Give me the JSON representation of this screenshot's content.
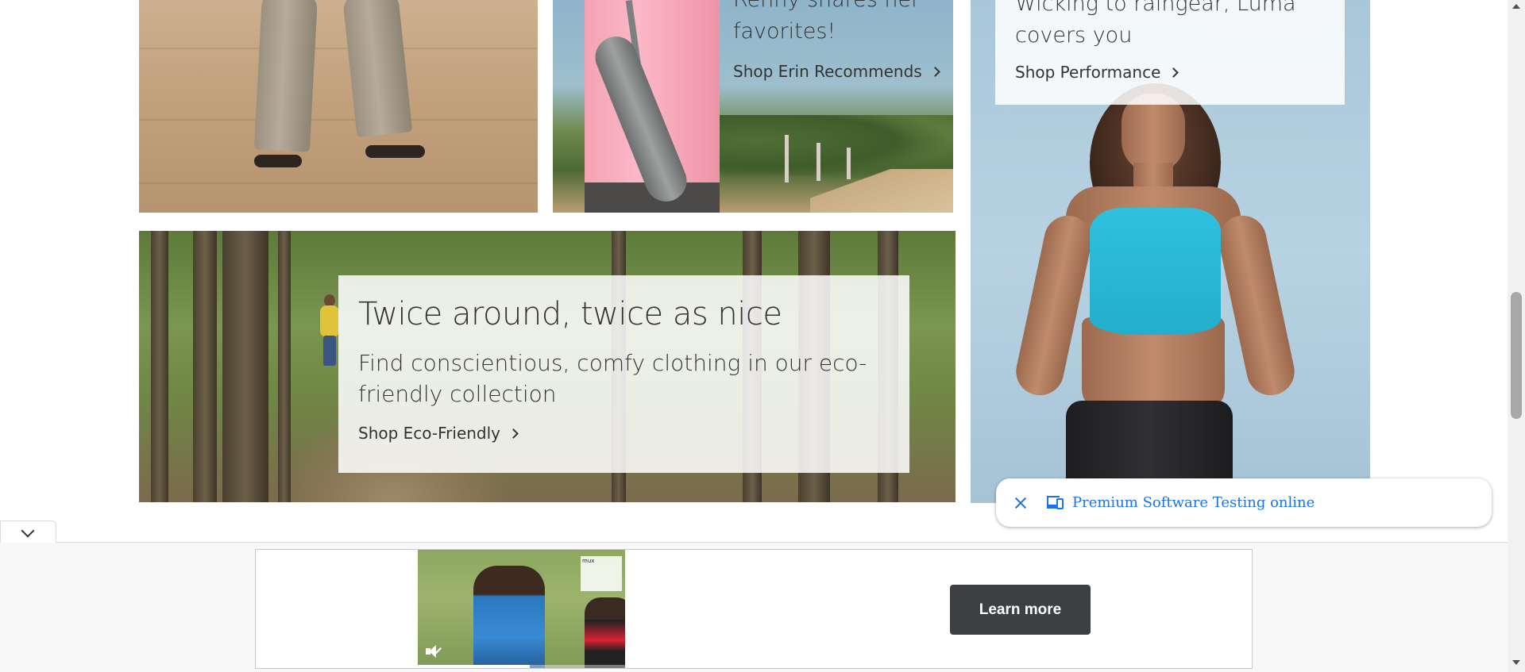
{
  "promos": {
    "erin": {
      "heading": "Renny shares her favorites!",
      "cta": "Shop Erin Recommends"
    },
    "performance": {
      "heading": "Wicking to raingear, Luma covers you",
      "cta": "Shop Performance"
    },
    "eco": {
      "heading": "Twice around, twice as nice",
      "subheading": "Find conscientious, comfy clothing in our eco-friendly collection",
      "cta": "Shop Eco-Friendly"
    }
  },
  "toast": {
    "label": "Premium Software Testing online",
    "icons": [
      "close-icon",
      "devices-icon"
    ],
    "accent": "#1a73e8"
  },
  "ad": {
    "button_label": "Learn more",
    "video_badge": "mux",
    "collapse_icon": "chevron-down-icon",
    "mute_icon": "muted-speaker-icon",
    "progress": 0.54
  },
  "colors": {
    "text": "#333333",
    "button_bg": "#3c4043"
  }
}
